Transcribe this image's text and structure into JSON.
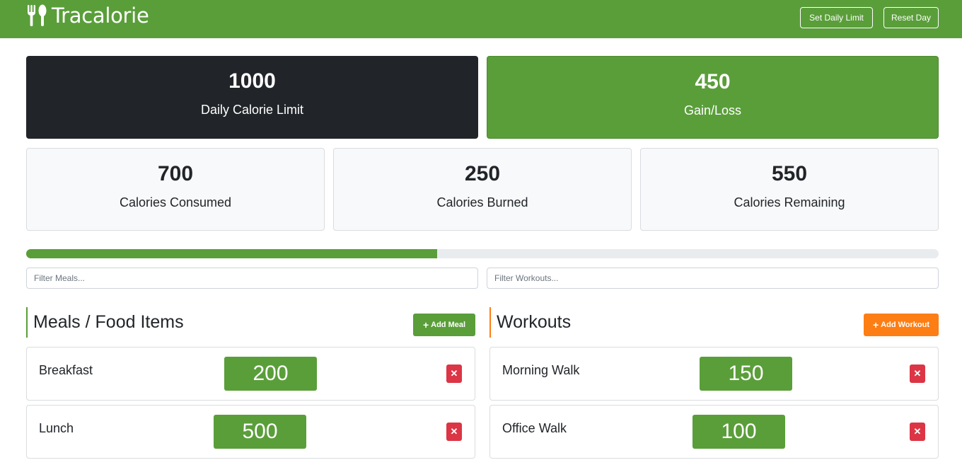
{
  "navbar": {
    "brand": "Tracalorie",
    "brand_icon": "utensils-icon",
    "set_limit_label": "Set Daily Limit",
    "reset_label": "Reset Day",
    "color": "#5a9e3a"
  },
  "stats": {
    "limit": {
      "value": "1000",
      "label": "Daily Calorie Limit"
    },
    "gain_loss": {
      "value": "450",
      "label": "Gain/Loss"
    },
    "consumed": {
      "value": "700",
      "label": "Calories Consumed"
    },
    "burned": {
      "value": "250",
      "label": "Calories Burned"
    },
    "remaining": {
      "value": "550",
      "label": "Calories Remaining"
    }
  },
  "progress": {
    "percent": 45
  },
  "filters": {
    "meals_placeholder": "Filter Meals...",
    "workouts_placeholder": "Filter Workouts..."
  },
  "meals": {
    "title": "Meals / Food Items",
    "add_label": "Add Meal",
    "items": [
      {
        "name": "Breakfast",
        "calories": "200"
      },
      {
        "name": "Lunch",
        "calories": "500"
      }
    ]
  },
  "workouts": {
    "title": "Workouts",
    "add_label": "Add Workout",
    "items": [
      {
        "name": "Morning Walk",
        "calories": "150"
      },
      {
        "name": "Office Walk",
        "calories": "100"
      }
    ]
  },
  "colors": {
    "green": "#5a9e3a",
    "dark": "#212529",
    "orange": "#fd7e14",
    "danger": "#dc3545"
  },
  "icons": {
    "add": "plus-icon",
    "delete": "close-icon"
  }
}
